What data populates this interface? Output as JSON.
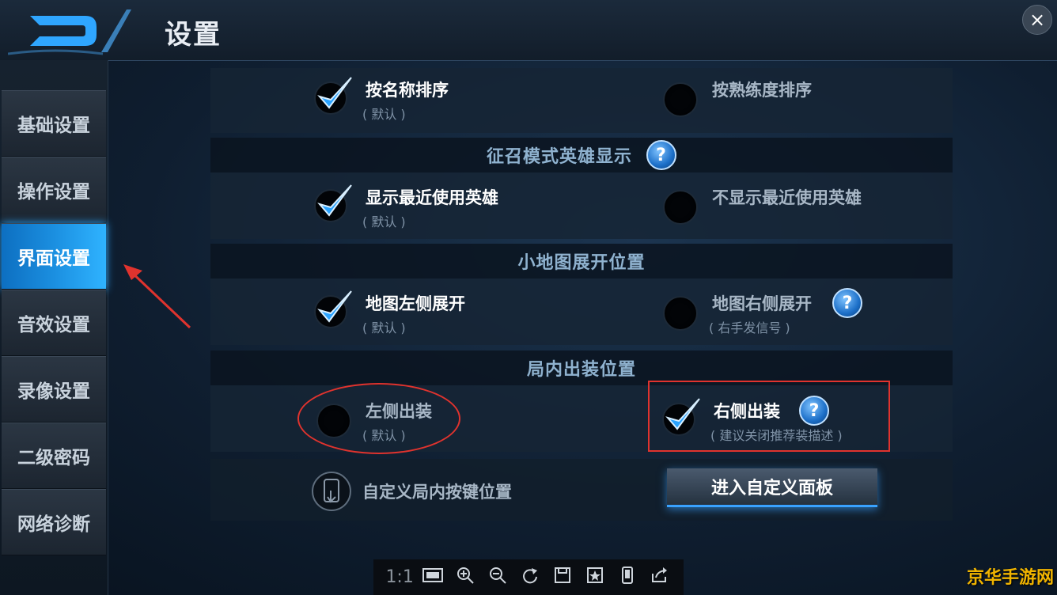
{
  "header": {
    "title": "设置",
    "close_icon": "×"
  },
  "sidebar": {
    "items": [
      {
        "label": "基础设置",
        "active": false
      },
      {
        "label": "操作设置",
        "active": false
      },
      {
        "label": "界面设置",
        "active": true
      },
      {
        "label": "音效设置",
        "active": false
      },
      {
        "label": "录像设置",
        "active": false
      },
      {
        "label": "二级密码",
        "active": false
      },
      {
        "label": "网络诊断",
        "active": false
      }
    ]
  },
  "sort": {
    "by_name": {
      "label": "按名称排序",
      "sub": "( 默认 )",
      "checked": true
    },
    "by_proficiency": {
      "label": "按熟练度排序",
      "checked": false
    }
  },
  "recruit": {
    "heading": "征召模式英雄显示",
    "help": "?",
    "show_recent": {
      "label": "显示最近使用英雄",
      "sub": "( 默认 )",
      "checked": true
    },
    "hide_recent": {
      "label": "不显示最近使用英雄",
      "checked": false
    }
  },
  "minimap": {
    "heading": "小地图展开位置",
    "left": {
      "label": "地图左侧展开",
      "sub": "( 默认 )",
      "checked": true
    },
    "right": {
      "label": "地图右侧展开",
      "sub": "( 右手发信号 )",
      "checked": false,
      "help": "?"
    }
  },
  "shop": {
    "heading": "局内出装位置",
    "left": {
      "label": "左侧出装",
      "sub": "( 默认 )",
      "checked": false
    },
    "right": {
      "label": "右侧出装",
      "sub": "( 建议关闭推荐装描述 )",
      "checked": true,
      "help": "?"
    }
  },
  "custom": {
    "label": "自定义局内按键位置",
    "button": "进入自定义面板",
    "icon": "phone-touch-icon"
  },
  "viewer_toolbar": {
    "ratio": "1:1",
    "icons": [
      "fit-screen-icon",
      "zoom-in-icon",
      "zoom-out-icon",
      "rotate-icon",
      "save-icon",
      "favorite-icon",
      "device-icon",
      "share-icon"
    ]
  },
  "watermark": "京华手游网",
  "colors": {
    "accent": "#1b8fe0",
    "annotation_red": "#e0332e",
    "watermark": "#f0b400"
  }
}
